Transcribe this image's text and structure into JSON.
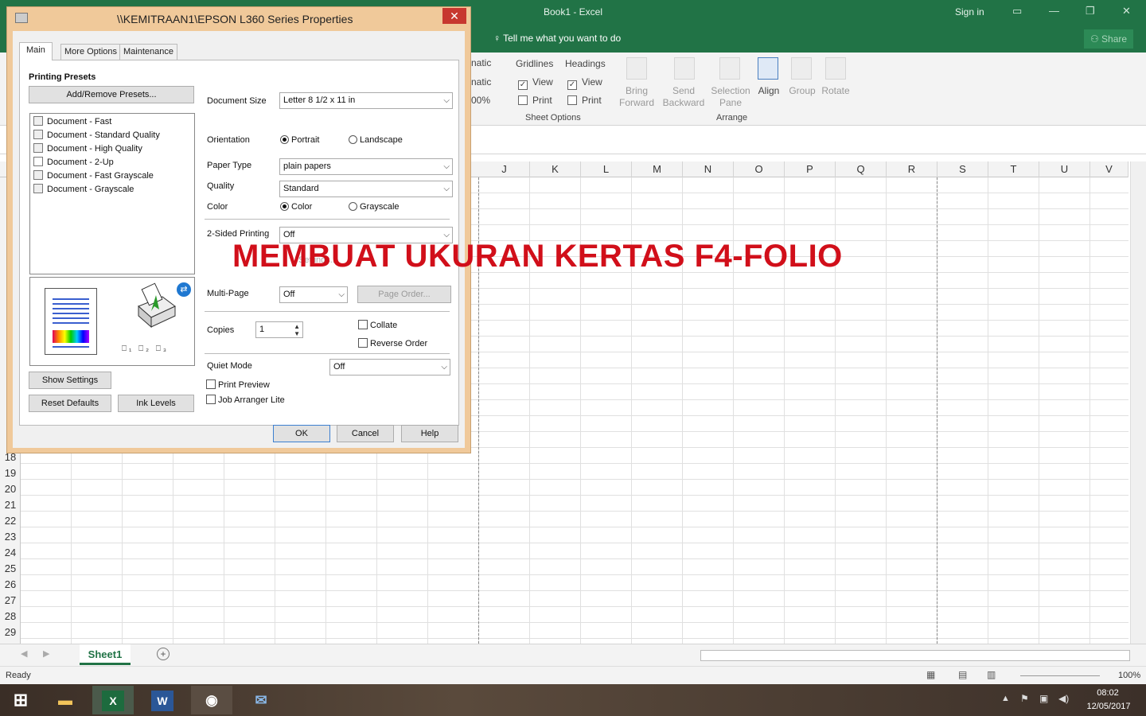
{
  "excel": {
    "title": "Book1  -  Excel",
    "signin": "Sign in",
    "share": "Share",
    "tellme": "Tell me what you want to do",
    "ribbon": {
      "partial": [
        "natic",
        "natic",
        "00%"
      ],
      "gridlines_label": "Gridlines",
      "headings_label": "Headings",
      "view": "View",
      "print": "Print",
      "sheet_options": "Sheet Options",
      "bring_forward": [
        "Bring",
        "Forward"
      ],
      "send_backward": [
        "Send",
        "Backward"
      ],
      "selection_pane": [
        "Selection",
        "Pane"
      ],
      "align": "Align",
      "group": "Group",
      "rotate": "Rotate",
      "arrange": "Arrange"
    },
    "columns": [
      "J",
      "K",
      "L",
      "M",
      "N",
      "O",
      "P",
      "Q",
      "R",
      "S",
      "T",
      "U",
      "V"
    ],
    "rows": [
      "18",
      "19",
      "20",
      "21",
      "22",
      "23",
      "24",
      "25",
      "26",
      "27",
      "28",
      "29"
    ],
    "sheet_tab": "Sheet1",
    "status": "Ready",
    "zoom": "100%"
  },
  "taskbar": {
    "time": "08:02",
    "date": "12/05/2017"
  },
  "headline": "MEMBUAT UKURAN KERTAS F4-FOLIO",
  "dialog": {
    "title": "\\\\KEMITRAAN1\\EPSON L360 Series Properties",
    "tabs": [
      "Main",
      "More Options",
      "Maintenance"
    ],
    "printing_presets": "Printing Presets",
    "add_remove": "Add/Remove Presets...",
    "presets": [
      "Document - Fast",
      "Document - Standard Quality",
      "Document - High Quality",
      "Document - 2-Up",
      "Document - Fast Grayscale",
      "Document - Grayscale"
    ],
    "document_size_label": "Document Size",
    "document_size": "Letter 8 1/2 x 11 in",
    "orientation_label": "Orientation",
    "portrait": "Portrait",
    "landscape": "Landscape",
    "paper_type_label": "Paper Type",
    "paper_type": "plain papers",
    "quality_label": "Quality",
    "quality": "Standard",
    "color_label": "Color",
    "color": "Color",
    "grayscale": "Grayscale",
    "two_sided_label": "2-Sided Printing",
    "two_sided": "Off",
    "settings_hidden": "Settings...",
    "multipage_label": "Multi-Page",
    "multipage": "Off",
    "page_order": "Page Order...",
    "copies_label": "Copies",
    "copies": "1",
    "collate": "Collate",
    "reverse_order": "Reverse Order",
    "quiet_mode_label": "Quiet Mode",
    "quiet_mode": "Off",
    "print_preview": "Print Preview",
    "job_arranger": "Job Arranger Lite",
    "show_settings": "Show Settings",
    "reset_defaults": "Reset Defaults",
    "ink_levels": "Ink Levels",
    "ok": "OK",
    "cancel": "Cancel",
    "help": "Help"
  }
}
